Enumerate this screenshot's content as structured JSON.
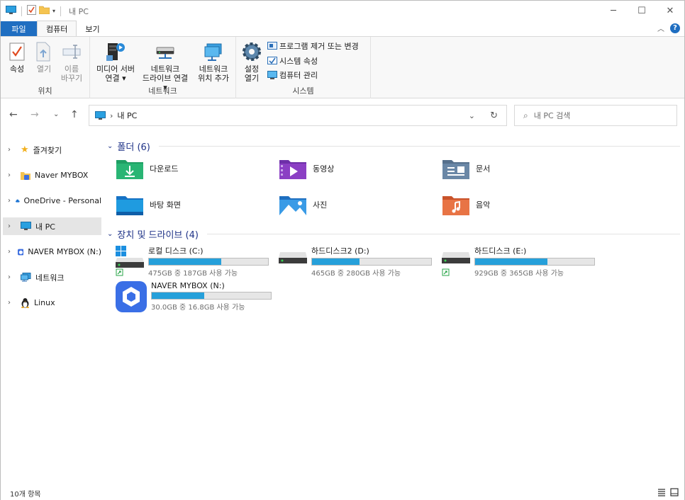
{
  "title": "내 PC",
  "tabs": [
    "파일",
    "컴퓨터",
    "보기"
  ],
  "ribbon": {
    "location": {
      "label": "위치",
      "properties": "속성",
      "open": "열기",
      "rename_1": "이름",
      "rename_2": "바꾸기"
    },
    "network": {
      "label": "네트워크",
      "media_1": "미디어 서버",
      "media_2": "연결",
      "map_1": "네트워크",
      "map_2": "드라이브 연결",
      "add_1": "네트워크",
      "add_2": "위치 추가"
    },
    "system": {
      "label": "시스템",
      "settings_1": "설정",
      "settings_2": "열기",
      "uninstall": "프로그램 제거 또는 변경",
      "sysprops": "시스템 속성",
      "manage": "컴퓨터 관리"
    }
  },
  "address": {
    "path": "내 PC",
    "search_placeholder": "내 PC 검색"
  },
  "nav": [
    {
      "label": "즐겨찾기"
    },
    {
      "label": "Naver MYBOX"
    },
    {
      "label": "OneDrive - Personal"
    },
    {
      "label": "내 PC"
    },
    {
      "label": "NAVER MYBOX (N:)"
    },
    {
      "label": "네트워크"
    },
    {
      "label": "Linux"
    }
  ],
  "folders_header": "폴더 (6)",
  "folders": [
    {
      "name": "다운로드",
      "color": "#1e9e63"
    },
    {
      "name": "동영상",
      "color": "#8b3fc4"
    },
    {
      "name": "문서",
      "color": "#6a7f98"
    },
    {
      "name": "바탕 화면",
      "color": "#1f8fd8"
    },
    {
      "name": "사진",
      "color": "#2b82d6"
    },
    {
      "name": "음악",
      "color": "#e06a3c"
    }
  ],
  "drives_header": "장치 및 드라이브 (4)",
  "drives": [
    {
      "name": "로컬 디스크 (C:)",
      "detail": "475GB 중 187GB 사용 가능",
      "used_fraction": 0.61
    },
    {
      "name": "하드디스크2 (D:)",
      "detail": "465GB 중 280GB 사용 가능",
      "used_fraction": 0.4
    },
    {
      "name": "하드디스크 (E:)",
      "detail": "929GB 중 365GB 사용 가능",
      "used_fraction": 0.61
    },
    {
      "name": "NAVER MYBOX (N:)",
      "detail": "30.0GB 중 16.8GB 사용 가능",
      "used_fraction": 0.44
    }
  ],
  "status": "10개 항목",
  "colors": {
    "accent": "#1f6ec1",
    "bar_fill": "#26a0da",
    "section_header": "#1e3287"
  }
}
